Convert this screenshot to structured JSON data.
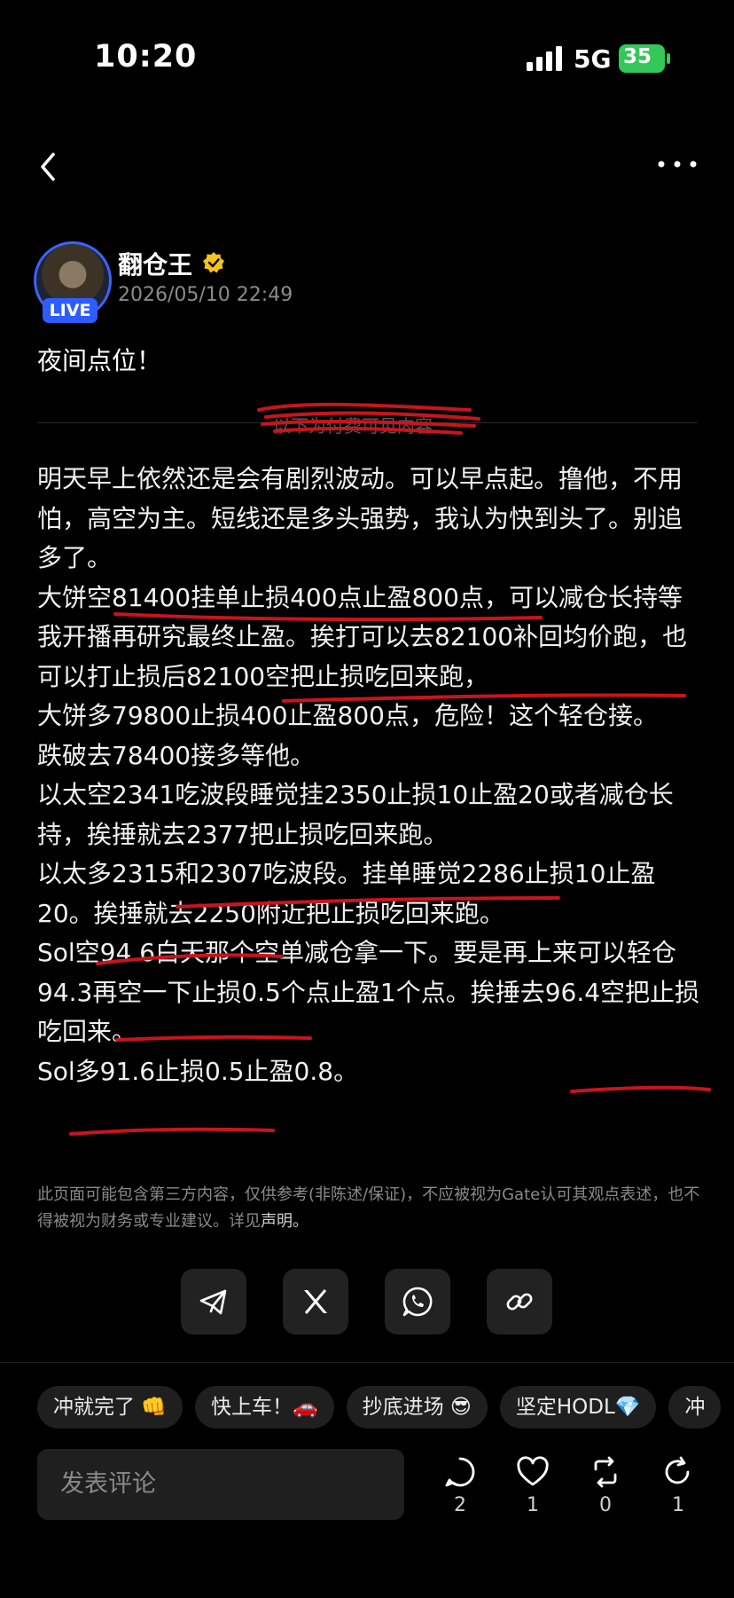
{
  "status_bar": {
    "time": "10:20",
    "network": "5G",
    "battery": "35"
  },
  "author": {
    "name": "翻仓王",
    "date": "2026/05/10 22:49",
    "live_badge": "LIVE"
  },
  "post": {
    "title": "夜间点位！",
    "divider_label": "以下为付费可见内容",
    "paragraphs": [
      "明天早上依然还是会有剧烈波动。可以早点起。撸他，不用怕，高空为主。短线还是多头强势，我认为快到头了。别追多了。",
      "大饼空81400挂单止损400点止盈800点，可以减仓长持等我开播再研究最终止盈。挨打可以去82100补回均价跑，也可以打止损后82100空把止损吃回来跑，",
      "大饼多79800止损400止盈800点，危险！这个轻仓接。",
      "跌破去78400接多等他。",
      "以太空2341吃波段睡觉挂2350止损10止盈20或者减仓长持，挨捶就去2377把止损吃回来跑。",
      "以太多2315和2307吃波段。挂单睡觉2286止损10止盈20。挨捶就去2250附近把止损吃回来跑。",
      "Sol空94.6白天那个空单减仓拿一下。要是再上来可以轻仓94.3再空一下止损0.5个点止盈1个点。挨捶去96.4空把止损吃回来。",
      "Sol多91.6止损0.5止盈0.8。"
    ],
    "disclaimer": "此页面可能包含第三方内容，仅供参考(非陈述/保证)，不应被视为Gate认可其观点表述，也不得被视为财务或专业建议。详见",
    "disclaimer_link": "声明。"
  },
  "share_buttons": [
    "telegram-icon",
    "x-icon",
    "whatsapp-icon",
    "link-icon"
  ],
  "reaction_chips": [
    "冲就完了 👊",
    "快上车！🚗",
    "抄底进场 😎",
    "坚定HODL💎",
    "冲"
  ],
  "comment": {
    "placeholder": "发表评论"
  },
  "actions": {
    "comments": "2",
    "likes": "1",
    "reposts": "0",
    "shares": "1"
  },
  "colors": {
    "background": "#000000",
    "accent": "#2f5cff",
    "live": "#2f5cff",
    "verified": "#f5c518",
    "battery": "#34c759",
    "annotation": "#c8141e"
  }
}
